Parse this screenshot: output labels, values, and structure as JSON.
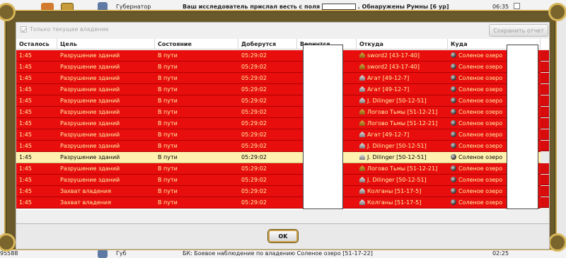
{
  "background": {
    "top_sender": "Губернатор",
    "top_subject_prefix": "Ваш исследователь прислал весть с поля",
    "top_subject_suffix": ". Обнаружены Румны [6 ур]",
    "top_time": "06:35",
    "bottom_sender": "Губ",
    "bottom_subject": "БК: Боевое наблюдение по владению Соленое озеро [51-17-22]",
    "bottom_time": "02:25",
    "bottom_left_number": "95588"
  },
  "dialog": {
    "only_current_label": "Только текущее владение",
    "save_report_label": "Сохранить отчет",
    "ok_label": "OK",
    "close_icon": "close-icon",
    "columns": [
      "Осталось",
      "Цель",
      "Состояние",
      "Доберутся",
      "Вернутся",
      "Откуда",
      "Куда"
    ],
    "rows": [
      {
        "left": "1:45",
        "goal": "Разрушение зданий",
        "state": "В пути",
        "arrive": "05:29:02",
        "return": "",
        "from": "sword2 [43-17-40]",
        "from_icon": "house-gold",
        "to": "Соленое озеро",
        "to_icon": "lake-icon",
        "selected": false
      },
      {
        "left": "1:45",
        "goal": "Разрушение зданий",
        "state": "В пути",
        "arrive": "05:29:02",
        "return": "",
        "from": "sword2 [43-17-40]",
        "from_icon": "house-gold",
        "to": "Соленое озеро",
        "to_icon": "lake-icon",
        "selected": false
      },
      {
        "left": "1:45",
        "goal": "Разрушение зданий",
        "state": "В пути",
        "arrive": "05:29:02",
        "return": "",
        "from": "Агат [49-12-7]",
        "from_icon": "house-grey",
        "to": "Соленое озеро",
        "to_icon": "lake-icon",
        "selected": false
      },
      {
        "left": "1:45",
        "goal": "Разрушение зданий",
        "state": "В пути",
        "arrive": "05:29:02",
        "return": "",
        "from": "Агат [49-12-7]",
        "from_icon": "house-grey",
        "to": "Соленое озеро",
        "to_icon": "lake-icon",
        "selected": false
      },
      {
        "left": "1:45",
        "goal": "Разрушение зданий",
        "state": "В пути",
        "arrive": "05:29:02",
        "return": "",
        "from": "J. Dilinger [50-12-51]",
        "from_icon": "house-grey",
        "to": "Соленое озеро",
        "to_icon": "lake-icon",
        "selected": false
      },
      {
        "left": "1:45",
        "goal": "Разрушение зданий",
        "state": "В пути",
        "arrive": "05:29:02",
        "return": "",
        "from": "Логово Тьмы [51-12-21]",
        "from_icon": "house-gold",
        "to": "Соленое озеро",
        "to_icon": "lake-icon",
        "selected": false
      },
      {
        "left": "1:45",
        "goal": "Разрушение зданий",
        "state": "В пути",
        "arrive": "05:29:02",
        "return": "",
        "from": "Логово Тьмы [51-12-21]",
        "from_icon": "house-gold",
        "to": "Соленое озеро",
        "to_icon": "lake-icon",
        "selected": false
      },
      {
        "left": "1:45",
        "goal": "Разрушение зданий",
        "state": "В пути",
        "arrive": "05:29:02",
        "return": "",
        "from": "Агат [49-12-7]",
        "from_icon": "house-grey",
        "to": "Соленое озеро",
        "to_icon": "lake-icon",
        "selected": false
      },
      {
        "left": "1:45",
        "goal": "Разрушение зданий",
        "state": "В пути",
        "arrive": "05:29:02",
        "return": "",
        "from": "J. Dilinger [50-12-51]",
        "from_icon": "house-grey",
        "to": "Соленое озеро",
        "to_icon": "lake-icon",
        "selected": false
      },
      {
        "left": "1:45",
        "goal": "Разрушение зданий",
        "state": "В пути",
        "arrive": "05:29:02",
        "return": "",
        "from": "J. Dilinger [50-12-51]",
        "from_icon": "house-grey",
        "to": "Соленое озеро",
        "to_icon": "lake-icon",
        "selected": true
      },
      {
        "left": "1:45",
        "goal": "Разрушение зданий",
        "state": "В пути",
        "arrive": "05:29:02",
        "return": "",
        "from": "Логово Тьмы [51-12-21]",
        "from_icon": "house-gold",
        "to": "Соленое озеро",
        "to_icon": "lake-icon",
        "selected": false
      },
      {
        "left": "1:45",
        "goal": "Разрушение зданий",
        "state": "В пути",
        "arrive": "05:29:02",
        "return": "",
        "from": "J. Dilinger [50-12-51]",
        "from_icon": "house-grey",
        "to": "Соленое озеро",
        "to_icon": "lake-icon",
        "selected": false
      },
      {
        "left": "1:45",
        "goal": "Захват владения",
        "state": "В пути",
        "arrive": "05:29:02",
        "return": "",
        "from": "Колганы [51-17-5]",
        "from_icon": "house-grey",
        "to": "Соленое озеро",
        "to_icon": "lake-icon",
        "selected": false
      },
      {
        "left": "1:45",
        "goal": "Захват владения",
        "state": "В пути",
        "arrive": "05:29:02",
        "return": "",
        "from": "Колганы [51-17-5]",
        "from_icon": "house-grey",
        "to": "Соленое озеро",
        "to_icon": "lake-icon",
        "selected": false
      }
    ]
  }
}
